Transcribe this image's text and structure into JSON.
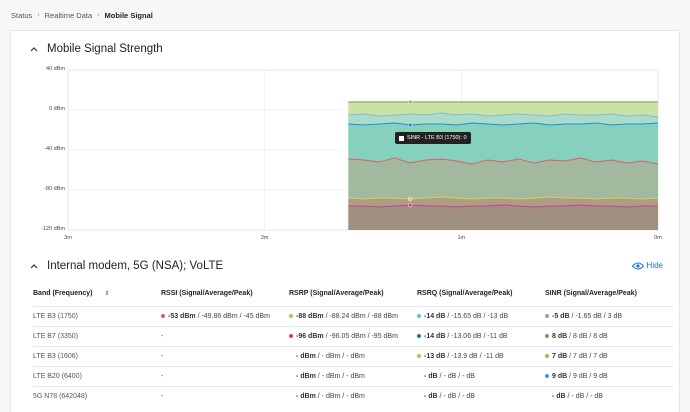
{
  "breadcrumb": {
    "items": [
      "Status",
      "Realtime Data",
      "Mobile Signal"
    ]
  },
  "chart_section": {
    "title": "Mobile Signal Strength"
  },
  "chart_data": {
    "type": "area",
    "y_ticks": [
      "40 dBm",
      "0 dBm",
      "-40 dBm",
      "-80 dBm",
      "-120 dBm"
    ],
    "x_ticks": [
      "3m",
      "2m",
      "1m",
      "0m"
    ],
    "ylim": [
      -120,
      40
    ],
    "grid": true,
    "tooltip": "SINR - LTE B3 (1750): 0",
    "series": [
      {
        "name": "SINR - LTE B3 (1750)",
        "color": "#8fbf6a",
        "values": [
          8,
          8,
          8,
          8,
          8,
          8,
          8,
          8,
          8,
          8,
          8,
          8,
          8,
          8,
          8,
          8,
          8,
          8,
          8,
          8,
          8
        ]
      },
      {
        "color": "#7dbfd2",
        "values": [
          -5,
          -4,
          -6,
          -5,
          -4,
          -5,
          -3,
          -5,
          -4,
          -6,
          -5,
          -4,
          -5,
          -6,
          -4,
          -5,
          -5,
          -4,
          -6,
          -5,
          -7
        ]
      },
      {
        "color": "#1e8fd6",
        "values": [
          -14,
          -15,
          -14,
          -13,
          -15,
          -14,
          -14,
          -15,
          -13,
          -14,
          -15,
          -14,
          -13,
          -15,
          -14,
          -14,
          -13,
          -15,
          -14,
          -14,
          -13
        ]
      },
      {
        "color": "#e05a63",
        "values": [
          -49,
          -50,
          -52,
          -48,
          -53,
          -50,
          -49,
          -51,
          -54,
          -50,
          -52,
          -49,
          -53,
          -50,
          -51,
          -48,
          -52,
          -50,
          -53,
          -51,
          -54
        ]
      },
      {
        "color": "#d6d44a",
        "values": [
          -88,
          -89,
          -88,
          -88,
          -89,
          -88,
          -87,
          -88,
          -89,
          -88,
          -88,
          -89,
          -88,
          -87,
          -88,
          -88,
          -89,
          -88,
          -88,
          -89,
          -88
        ]
      },
      {
        "color": "#d63a8f",
        "values": [
          -96,
          -96,
          -97,
          -96,
          -95,
          -96,
          -96,
          -97,
          -96,
          -96,
          -95,
          -96,
          -97,
          -96,
          -96,
          -95,
          -96,
          -96,
          -97,
          -96,
          -96
        ]
      }
    ]
  },
  "modem_section": {
    "title": "Internal modem, 5G (NSA); VoLTE",
    "hide_label": "Hide"
  },
  "table": {
    "headers": [
      "Band (Frequency)",
      "RSSI (Signal/Average/Peak)",
      "RSRP (Signal/Average/Peak)",
      "RSRQ (Signal/Average/Peak)",
      "SINR (Signal/Average/Peak)"
    ],
    "rows": [
      {
        "band": "LTE B3 (1750)",
        "rssi": {
          "main": "-53 dBm",
          "rest": " / -49.86 dBm / -45 dBm",
          "color": "#e05a63"
        },
        "rsrp": {
          "main": "-88 dBm",
          "rest": " / -88.24 dBm / -88 dBm",
          "color": "#d6b63a"
        },
        "rsrq": {
          "main": "-14 dB",
          "rest": " / -15.65 dB / -13 dB",
          "color": "#5bbfd6"
        },
        "sinr": {
          "main": "-5 dB",
          "rest": " / -1.65 dB / 3 dB",
          "color": "#7fa8c0"
        }
      },
      {
        "band": "LTE B7 (3350)",
        "rssi": {
          "main": "-",
          "rest": "",
          "color": ""
        },
        "rsrp": {
          "main": "-96 dBm",
          "rest": " / -96.05 dBm / -95 dBm",
          "color": "#d63a8f"
        },
        "rsrq": {
          "main": "-14 dB",
          "rest": " / -13.06 dB / -11 dB",
          "color": "#1e6fc0"
        },
        "sinr": {
          "main": "8 dB",
          "rest": " / 8 dB / 8 dB",
          "color": "#6aa84f"
        }
      },
      {
        "band": "LTE B3 (1606)",
        "rssi": {
          "main": "-",
          "rest": "",
          "color": ""
        },
        "rsrp": {
          "main": "- dBm",
          "rest": " / - dBm / - dBm",
          "color": ""
        },
        "rsrq": {
          "main": "-13 dB",
          "rest": " / -13.9 dB / -11 dB",
          "color": "#d6b63a"
        },
        "sinr": {
          "main": "7 dB",
          "rest": " / 7 dB / 7 dB",
          "color": "#c9a84a"
        }
      },
      {
        "band": "LTE B20 (6400)",
        "rssi": {
          "main": "-",
          "rest": "",
          "color": ""
        },
        "rsrp": {
          "main": "- dBm",
          "rest": " / - dBm / - dBm",
          "color": ""
        },
        "rsrq": {
          "main": "- dB",
          "rest": " / - dB / - dB",
          "color": ""
        },
        "sinr": {
          "main": "9 dB",
          "rest": " / 9 dB / 9 dB",
          "color": "#3a9fd6"
        }
      },
      {
        "band": "5G N78 (642048)",
        "rssi": {
          "main": "-",
          "rest": "",
          "color": ""
        },
        "rsrp": {
          "main": "- dBm",
          "rest": " / - dBm / - dBm",
          "color": ""
        },
        "rsrq": {
          "main": "- dB",
          "rest": " / - dB / - dB",
          "color": ""
        },
        "sinr": {
          "main": "- dB",
          "rest": " / - dB / - dB",
          "color": ""
        }
      }
    ]
  }
}
